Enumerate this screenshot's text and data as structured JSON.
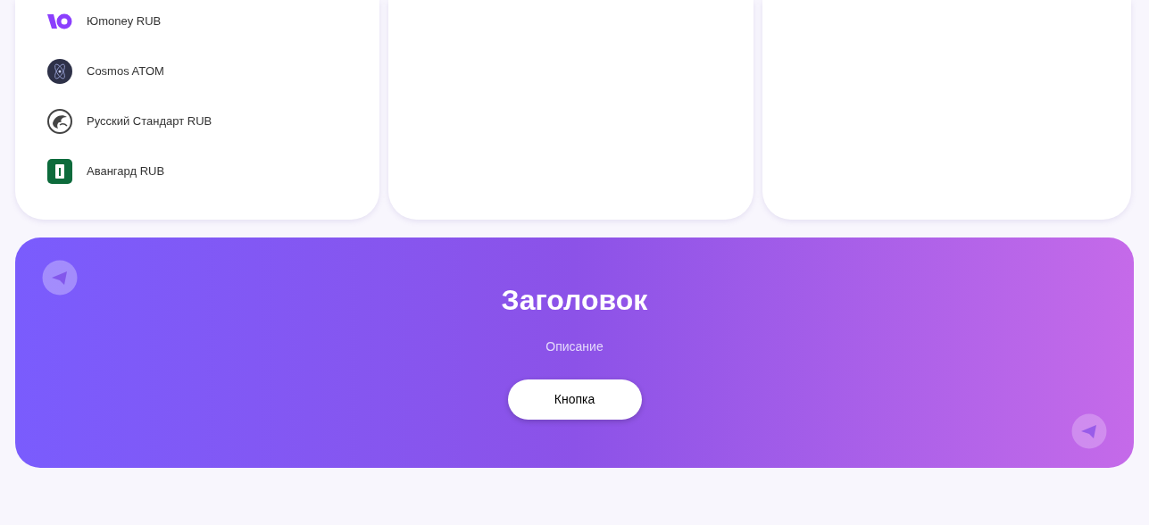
{
  "methods": [
    {
      "kind": "yoomoney",
      "label": "Юmoney RUB"
    },
    {
      "kind": "cosmos",
      "label": "Cosmos ATOM"
    },
    {
      "kind": "standard",
      "label": "Русский Стандарт RUB"
    },
    {
      "kind": "avangard",
      "label": "Авангард RUB"
    }
  ],
  "banner": {
    "title": "Заголовок",
    "description": "Описание",
    "button": "Кнопка"
  }
}
